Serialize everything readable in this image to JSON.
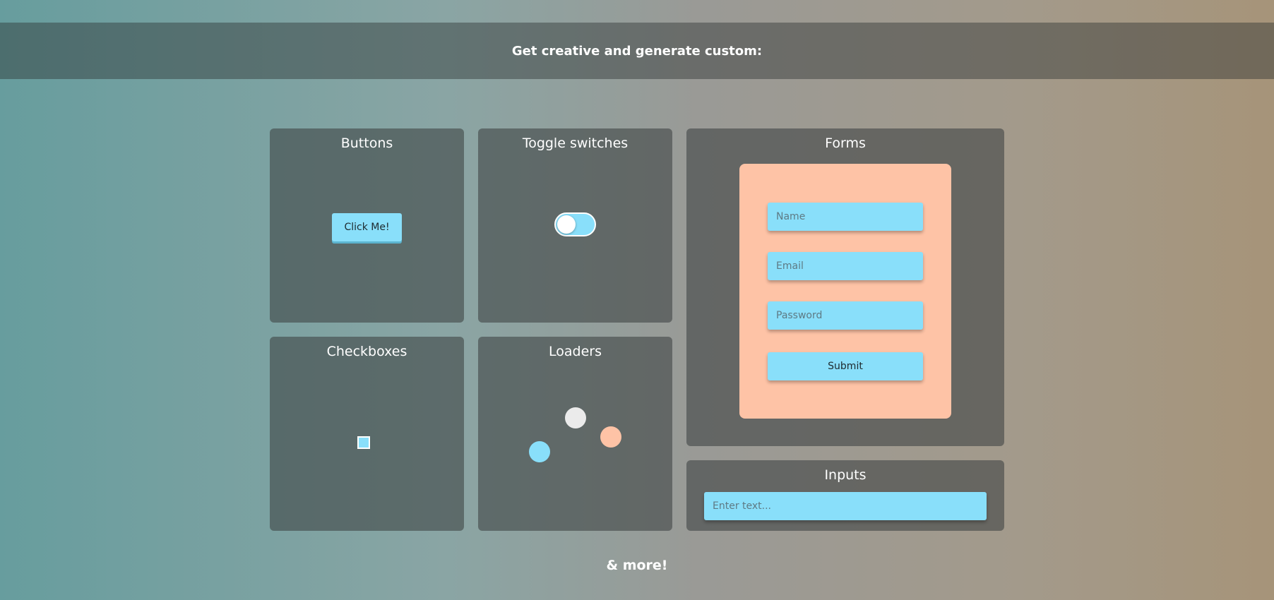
{
  "header": {
    "title": "Get creative and generate custom:"
  },
  "cards": {
    "buttons": {
      "title": "Buttons",
      "button_label": "Click Me!"
    },
    "toggles": {
      "title": "Toggle switches",
      "state": "off"
    },
    "checkboxes": {
      "title": "Checkboxes",
      "checked": false
    },
    "loaders": {
      "title": "Loaders"
    },
    "forms": {
      "title": "Forms",
      "name_placeholder": "Name",
      "email_placeholder": "Email",
      "password_placeholder": "Password",
      "submit_label": "Submit"
    },
    "inputs": {
      "title": "Inputs",
      "placeholder": "Enter text..."
    }
  },
  "footer": {
    "text": "& more!"
  },
  "colors": {
    "accent_blue": "#89dffa",
    "accent_peach": "#fec3a6",
    "loader_white": "#ebebeb"
  }
}
